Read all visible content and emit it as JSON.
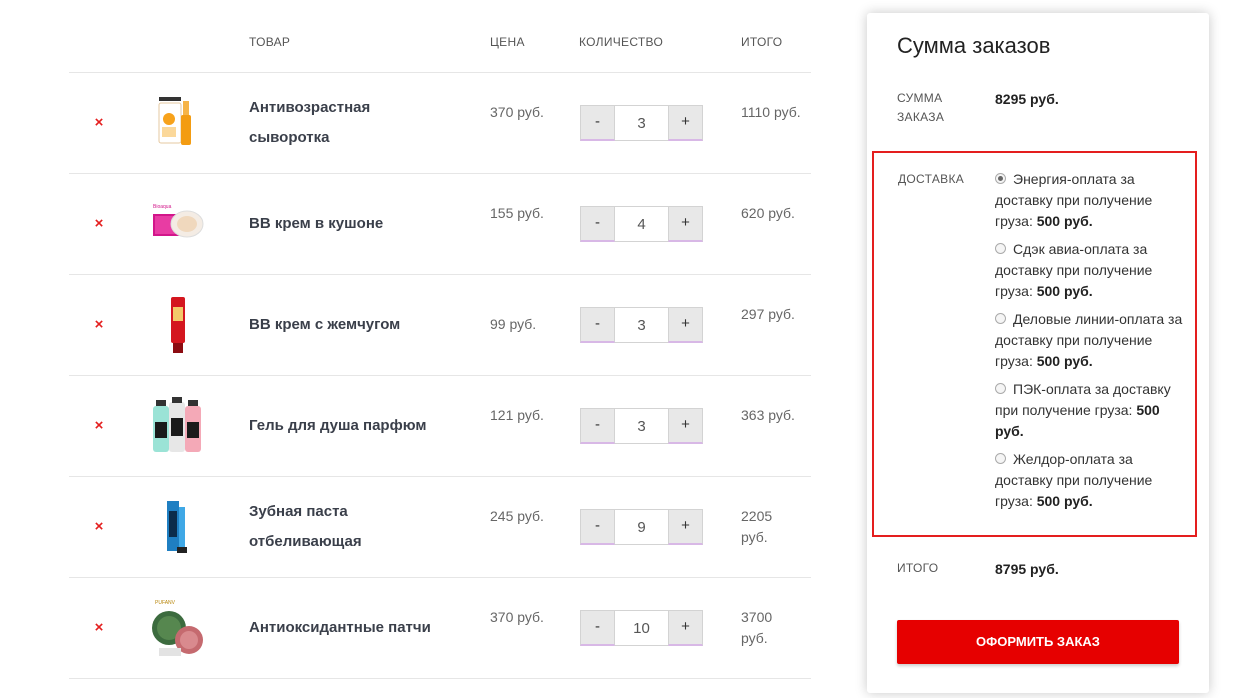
{
  "cart": {
    "headers": {
      "product": "ТОВАР",
      "price": "ЦЕНА",
      "qty": "КОЛИЧЕСТВО",
      "total": "ИТОГО"
    },
    "minus_label": "-",
    "plus_label": "+",
    "remove_icon": "×",
    "items": [
      {
        "name": "Антивозрастная сыворотка",
        "price": "370 руб.",
        "qty": "3",
        "total": "1110 руб.",
        "image": "serum-bottle"
      },
      {
        "name": "BB крем в кушоне",
        "price": "155 руб.",
        "qty": "4",
        "total": "620 руб.",
        "image": "cushion-compact"
      },
      {
        "name": "BB крем с жемчугом",
        "price": "99 руб.",
        "qty": "3",
        "total": "297 руб.",
        "image": "red-cream-tube"
      },
      {
        "name": "Гель для душа парфюм",
        "price": "121 руб.",
        "qty": "3",
        "total": "363 руб.",
        "image": "shower-gel-bottles"
      },
      {
        "name": "Зубная паста отбеливающая",
        "price": "245 руб.",
        "qty": "9",
        "total": "2205 руб.",
        "image": "toothpaste-box"
      },
      {
        "name": "Антиоксидантные патчи",
        "price": "370 руб.",
        "qty": "10",
        "total": "3700 руб.",
        "image": "eye-patches-jar"
      }
    ]
  },
  "summary": {
    "title": "Сумма заказов",
    "subtotal_label": "СУММА ЗАКАЗА",
    "subtotal_value": "8295 руб.",
    "delivery_label": "ДОСТАВКА",
    "delivery_options": [
      {
        "text": "Энергия-оплата за доставку при получение груза:",
        "price": "500 руб.",
        "checked": true
      },
      {
        "text": "Сдэк авиа-оплата за доставку при получение груза:",
        "price": "500 руб.",
        "checked": false
      },
      {
        "text": "Деловые линии-оплата за доставку при получение груза:",
        "price": "500 руб.",
        "checked": false
      },
      {
        "text": "ПЭК-оплата за доставку при получение груза:",
        "price": "500 руб.",
        "checked": false
      },
      {
        "text": "Желдор-оплата за доставку при получение груза:",
        "price": "500 руб.",
        "checked": false
      }
    ],
    "total_label": "ИТОГО",
    "total_value": "8795 руб.",
    "checkout_label": "ОФОРМИТЬ ЗАКАЗ"
  },
  "colors": {
    "accent": "#e60000",
    "remove": "#e41e1e",
    "highlight_border": "#e41e1e"
  }
}
